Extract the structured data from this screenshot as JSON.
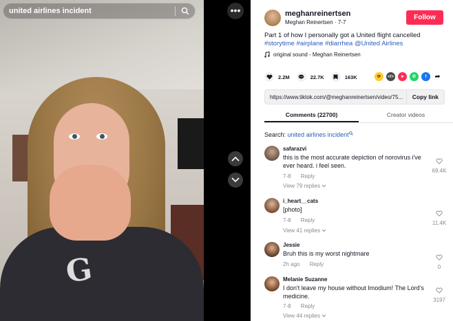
{
  "search": {
    "query": "united airlines incident"
  },
  "video": {
    "sweater_text": "G"
  },
  "post": {
    "username": "meghanreinertsen",
    "display_name": "Meghan Reinertsen",
    "date": "7-7",
    "subline": "Meghan Reinertsen · 7-7",
    "follow_label": "Follow",
    "caption_text": "Part 1 of how I personally got a United flight cancelled",
    "hashtags": [
      "#storytime",
      "#airplane",
      "#diarrhea",
      "@United Airlines"
    ],
    "sound": "original sound - Meghan Reinertsen",
    "likes": "2.2M",
    "comments": "22.7K",
    "saves": "163K",
    "link": "https://www.tiktok.com/@meghanreinertsen/video/75...",
    "copy_label": "Copy link"
  },
  "tabs": {
    "comments": "Comments (22700)",
    "creator": "Creator videos"
  },
  "comment_search": {
    "label": "Search:",
    "query": "united airlines incident"
  },
  "comments": [
    {
      "user": "safarazvi",
      "text": "this is the most accurate depiction of norovirus i've ever heard. i feel seen.",
      "date": "7-8",
      "reply": "Reply",
      "likes": "69.4K",
      "view": "View 79 replies"
    },
    {
      "user": "i_heart__cats",
      "text": "[photo]",
      "date": "7-8",
      "reply": "Reply",
      "likes": "11.4K",
      "view": "View 41 replies"
    },
    {
      "user": "Jessie",
      "text": "Bruh this is my worst nightmare",
      "date": "2h ago",
      "reply": "Reply",
      "likes": "0",
      "view": ""
    },
    {
      "user": "Melanie Suzanne",
      "text": "I don't leave my house without Imodium! The Lord's medicine.",
      "date": "7-8",
      "reply": "Reply",
      "likes": "3197",
      "view": "View 44 replies"
    }
  ],
  "colors": {
    "accent": "#fe2c55",
    "link": "#2b5db9"
  }
}
